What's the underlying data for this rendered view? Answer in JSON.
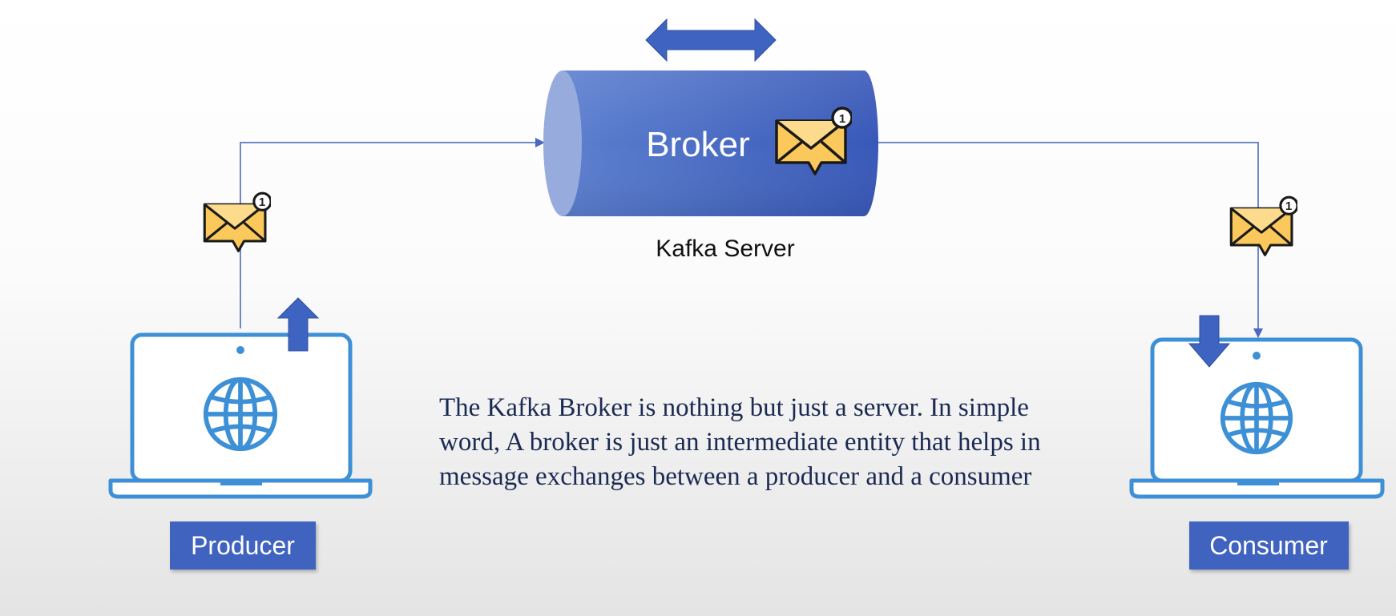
{
  "broker": {
    "label": "Broker"
  },
  "server": {
    "label": "Kafka Server"
  },
  "producer": {
    "label": "Producer"
  },
  "consumer": {
    "label": "Consumer"
  },
  "message": {
    "badge_count": "1"
  },
  "description": "The Kafka Broker is nothing but just a server. In simple word, A broker is just an intermediate entity that helps in message exchanges between a producer and a consumer",
  "colors": {
    "accent_blue": "#3f63c0",
    "laptop_outline": "#3e90d6",
    "envelope_fill": "#fbc95b",
    "connector_line": "#6f88c6",
    "text_dark": "#1b2a52"
  },
  "icons": [
    "double-arrow-icon",
    "envelope-icon",
    "globe-icon",
    "laptop-icon",
    "up-arrow-icon",
    "down-arrow-icon"
  ]
}
